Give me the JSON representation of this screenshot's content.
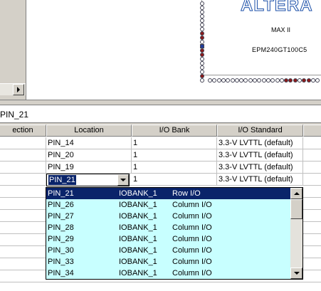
{
  "chip": {
    "logo": "ALTERA",
    "family": "MAX II",
    "part": "EPM240GT100C5"
  },
  "node_bar": {
    "value": "PIN_21"
  },
  "table": {
    "headers": [
      "ection",
      "Location",
      "I/O Bank",
      "I/O Standard"
    ],
    "rows": [
      {
        "location": "PIN_14",
        "bank": "1",
        "standard": "3.3-V LVTTL (default)"
      },
      {
        "location": "PIN_20",
        "bank": "1",
        "standard": "3.3-V LVTTL (default)"
      },
      {
        "location": "PIN_19",
        "bank": "1",
        "standard": "3.3-V LVTTL (default)"
      },
      {
        "location": "PIN_21",
        "bank": "1",
        "standard": "3.3-V LVTTL (default)"
      }
    ]
  },
  "combo": {
    "value": "PIN_21"
  },
  "dropdown": {
    "items": [
      {
        "pin": "PIN_21",
        "bank": "IOBANK_1",
        "type": "Row I/O",
        "selected": true
      },
      {
        "pin": "PIN_26",
        "bank": "IOBANK_1",
        "type": "Column I/O"
      },
      {
        "pin": "PIN_27",
        "bank": "IOBANK_1",
        "type": "Column I/O"
      },
      {
        "pin": "PIN_28",
        "bank": "IOBANK_1",
        "type": "Column I/O"
      },
      {
        "pin": "PIN_29",
        "bank": "IOBANK_1",
        "type": "Column I/O"
      },
      {
        "pin": "PIN_30",
        "bank": "IOBANK_1",
        "type": "Column I/O"
      },
      {
        "pin": "PIN_33",
        "bank": "IOBANK_1",
        "type": "Column I/O"
      },
      {
        "pin": "PIN_34",
        "bank": "IOBANK_1",
        "type": "Column I/O"
      }
    ]
  },
  "colors": {
    "selection": "#0a246a",
    "dropdown_bg": "#c8ffff",
    "pin_red": "#8b1a1a",
    "pin_blue": "#1f3c9a",
    "logo_blue": "#1b4fa8"
  }
}
